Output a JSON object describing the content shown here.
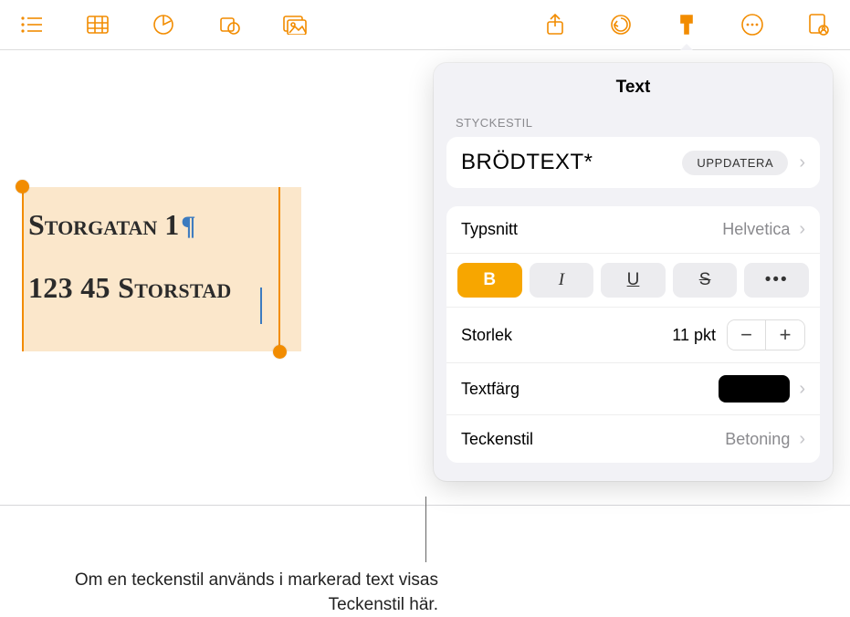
{
  "toolbar": {
    "icons": [
      "list",
      "table",
      "chart",
      "shape",
      "media",
      "share",
      "undo",
      "format",
      "more",
      "collab"
    ]
  },
  "canvas": {
    "line1": "Storgatan 1",
    "pilcrow": "¶",
    "line2": "123 45 Storstad"
  },
  "panel": {
    "title": "Text",
    "section_style": "STYCKESTIL",
    "style_name": "BRÖDTEXT*",
    "update": "UPPDATERA",
    "font_label": "Typsnitt",
    "font_value": "Helvetica",
    "bold": "B",
    "italic": "I",
    "underline": "U",
    "strike": "S",
    "more": "•••",
    "size_label": "Storlek",
    "size_value": "11 pkt",
    "color_label": "Textfärg",
    "color_value": "#000000",
    "charstyle_label": "Teckenstil",
    "charstyle_value": "Betoning"
  },
  "callout": "Om en teckenstil används i markerad text visas Teckenstil här."
}
